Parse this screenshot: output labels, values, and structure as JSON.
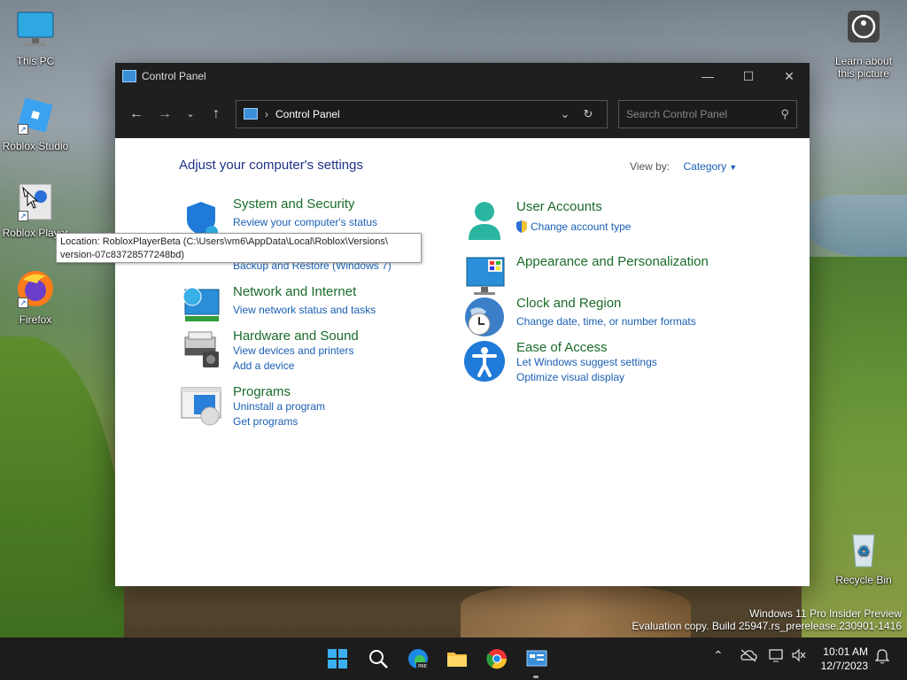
{
  "desktop": {
    "icons": [
      {
        "label": "This PC"
      },
      {
        "label": "Roblox Studio"
      },
      {
        "label": "Roblox Player"
      },
      {
        "label": "Firefox"
      },
      {
        "label": "Learn about this picture"
      },
      {
        "label": "Recycle Bin"
      }
    ]
  },
  "window": {
    "title": "Control Panel",
    "address": {
      "path": "Control Panel"
    },
    "search": {
      "placeholder": "Search Control Panel"
    },
    "heading": "Adjust your computer's settings",
    "view_by": {
      "label": "View by:",
      "value": "Category"
    },
    "categories_left": [
      {
        "title": "System and Security",
        "links": [
          "Review your computer's status",
          "Backup and Restore (Windows 7)"
        ]
      },
      {
        "title": "Network and Internet",
        "links": [
          "View network status and tasks"
        ]
      },
      {
        "title": "Hardware and Sound",
        "links": [
          "View devices and printers",
          "Add a device"
        ]
      },
      {
        "title": "Programs",
        "links": [
          "Uninstall a program",
          "Get programs"
        ]
      }
    ],
    "categories_right": [
      {
        "title": "User Accounts",
        "links": [
          "Change account type"
        ]
      },
      {
        "title": "Appearance and Personalization",
        "links": []
      },
      {
        "title": "Clock and Region",
        "links": [
          "Change date, time, or number formats"
        ]
      },
      {
        "title": "Ease of Access",
        "links": [
          "Let Windows suggest settings",
          "Optimize visual display"
        ]
      }
    ]
  },
  "tooltip": {
    "line1": "Location: RobloxPlayerBeta (C:\\Users\\vm6\\AppData\\Local\\Roblox\\Versions\\",
    "line2": "version-07c83728577248bd)"
  },
  "watermark": {
    "line1": "Windows 11 Pro Insider Preview",
    "line2": "Evaluation copy. Build 25947.rs_prerelease.230901-1416"
  },
  "taskbar": {
    "time": "10:01 AM",
    "date": "12/7/2023"
  },
  "colors": {
    "link": "#1a5fb4",
    "category_title": "#1a6b2a",
    "heading": "#1e3287",
    "titlebar": "#1f1f1f"
  }
}
